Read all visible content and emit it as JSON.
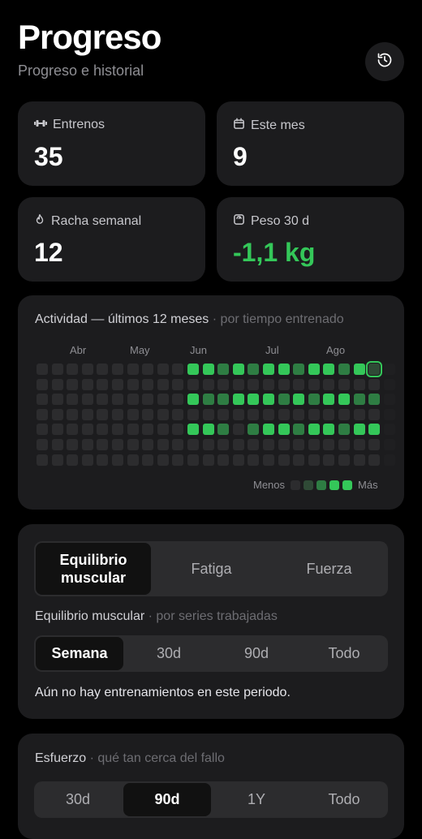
{
  "header": {
    "title": "Progreso",
    "subtitle": "Progreso e historial"
  },
  "stats": {
    "workouts": {
      "label": "Entrenos",
      "value": "35"
    },
    "this_month": {
      "label": "Este mes",
      "value": "9"
    },
    "weekly_streak": {
      "label": "Racha semanal",
      "value": "12"
    },
    "weight_30d": {
      "label": "Peso 30 d",
      "value": "-1,1 kg"
    }
  },
  "activity": {
    "title": "Actividad — últimos 12 meses",
    "subtitle": "· por tiempo entrenado",
    "months": [
      "Abr",
      "May",
      "Jun",
      "Jul",
      "Ago"
    ],
    "legend_less": "Menos",
    "legend_more": "Más",
    "colors": [
      "#2c2c2e",
      "#2f4a36",
      "#2e7d43",
      "#34c759"
    ],
    "grid": [
      [
        0,
        0,
        0,
        0,
        0,
        0,
        0,
        0,
        0,
        0,
        3,
        3,
        2,
        3,
        2,
        3,
        3,
        2,
        3,
        3,
        2,
        3,
        3,
        0
      ],
      [
        0,
        0,
        0,
        0,
        0,
        0,
        0,
        0,
        0,
        0,
        0,
        0,
        0,
        0,
        0,
        0,
        0,
        0,
        0,
        0,
        0,
        0,
        0,
        0
      ],
      [
        0,
        0,
        0,
        0,
        0,
        0,
        0,
        0,
        0,
        0,
        3,
        2,
        2,
        3,
        3,
        3,
        2,
        3,
        2,
        3,
        3,
        2,
        2,
        0
      ],
      [
        0,
        0,
        0,
        0,
        0,
        0,
        0,
        0,
        0,
        0,
        0,
        0,
        0,
        0,
        0,
        0,
        0,
        0,
        0,
        0,
        0,
        0,
        0,
        0
      ],
      [
        0,
        0,
        0,
        0,
        0,
        0,
        0,
        0,
        0,
        0,
        3,
        3,
        2,
        0,
        2,
        3,
        3,
        2,
        3,
        3,
        2,
        3,
        3,
        0
      ],
      [
        0,
        0,
        0,
        0,
        0,
        0,
        0,
        0,
        0,
        0,
        0,
        0,
        0,
        0,
        0,
        0,
        0,
        0,
        0,
        0,
        0,
        0,
        0,
        0
      ],
      [
        0,
        0,
        0,
        0,
        0,
        0,
        0,
        0,
        0,
        0,
        0,
        0,
        0,
        0,
        0,
        0,
        0,
        0,
        0,
        0,
        0,
        0,
        0,
        0
      ]
    ],
    "current_week_index": 22
  },
  "analysis": {
    "tabs": [
      "Equilibrio muscular",
      "Fatiga",
      "Fuerza"
    ],
    "active_tab": "Equilibrio muscular",
    "section_title": "Equilibrio muscular",
    "section_subtitle": "· por series trabajadas",
    "ranges": [
      "Semana",
      "30d",
      "90d",
      "Todo"
    ],
    "active_range": "Semana",
    "empty_message": "Aún no hay entrenamientos en este periodo."
  },
  "effort": {
    "title": "Esfuerzo",
    "subtitle": "· qué tan cerca del fallo",
    "ranges": [
      "30d",
      "90d",
      "1Y",
      "Todo"
    ],
    "active_range": "90d"
  }
}
